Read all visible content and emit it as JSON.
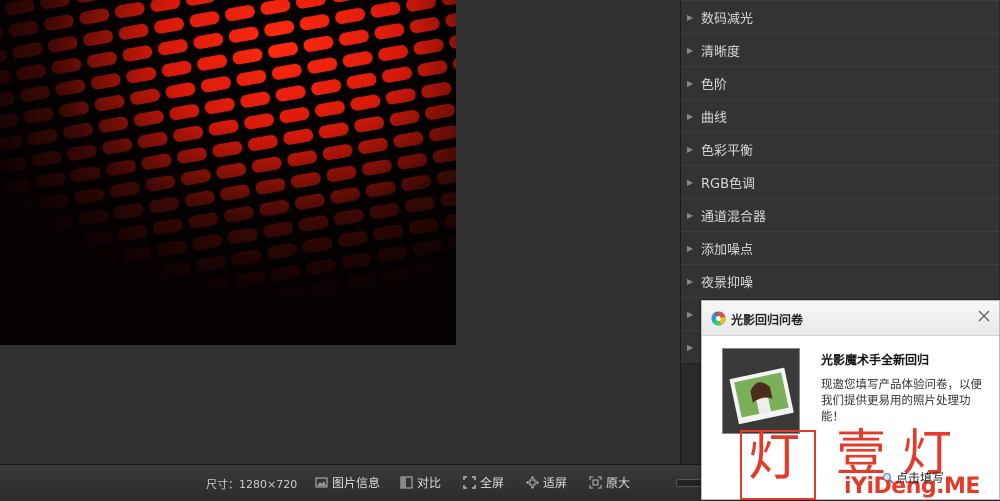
{
  "panel": {
    "items": [
      {
        "label": "数码减光"
      },
      {
        "label": "清晰度"
      },
      {
        "label": "色阶"
      },
      {
        "label": "曲线"
      },
      {
        "label": "色彩平衡"
      },
      {
        "label": "RGB色调"
      },
      {
        "label": "通道混合器"
      },
      {
        "label": "添加噪点"
      },
      {
        "label": "夜景抑噪"
      }
    ]
  },
  "toolbar": {
    "size_label": "尺寸：1280×720",
    "image_info": "图片信息",
    "compare": "对比",
    "fullscreen": "全屏",
    "fit_screen": "适屏",
    "original_size": "原大"
  },
  "survey": {
    "title": "光影回归问卷",
    "heading": "光影魔术手全新回归",
    "body": "现邀您填写产品体验问卷，以便我们提供更易用的照片处理功能！",
    "link": "点击填写"
  },
  "watermark": {
    "glyph1": "灯",
    "glyph2": "壹",
    "glyph3": "灯",
    "url": "iYiDeng.ME"
  },
  "colors": {
    "watermark": "#e43a2a",
    "panel_bg": "#333333"
  }
}
